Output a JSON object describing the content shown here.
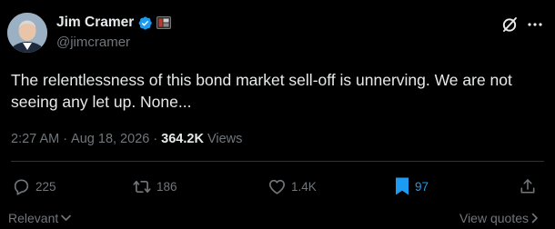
{
  "author": {
    "display_name": "Jim Cramer",
    "handle": "@jimcramer",
    "verified": true,
    "verified_color": "#1d9bf0"
  },
  "tweet": {
    "text": "The relentlessness of this bond market sell-off is unnerving. We are not seeing any let up. None..."
  },
  "meta": {
    "time": "2:27 AM",
    "separator_1": "·",
    "date": "Aug 18, 2026",
    "separator_2": "·",
    "views_count": "364.2K",
    "views_label": "Views"
  },
  "actions": {
    "replies": "225",
    "reposts": "186",
    "likes": "1.4K",
    "bookmarks": "97",
    "bookmark_active_color": "#1d9bf0"
  },
  "footer": {
    "sort_label": "Relevant",
    "view_quotes_label": "View quotes"
  },
  "icons": {
    "avatar": "avatar-icon",
    "verified": "verified-badge-icon",
    "affiliate": "affiliate-flag-icon",
    "grok": "grok-icon",
    "more": "more-icon",
    "reply": "reply-icon",
    "repost": "repost-icon",
    "like": "heart-icon",
    "bookmark": "bookmark-icon",
    "share": "share-icon"
  },
  "colors": {
    "background": "#000000",
    "text_primary": "#e7e9ea",
    "text_secondary": "#71767b",
    "accent": "#1d9bf0",
    "divider": "#2f3336"
  }
}
